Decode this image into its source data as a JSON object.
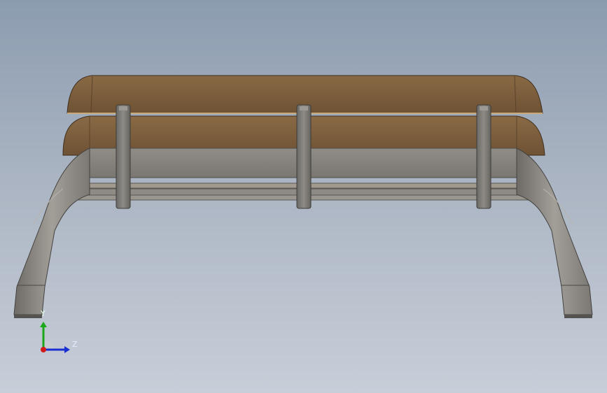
{
  "viewport": {
    "background_top": "#8c9cb0",
    "background_bottom": "#c7ced8"
  },
  "model": {
    "wood_color": "#7a5c3c",
    "wood_dark": "#5e4329",
    "metal_color": "#8a8680",
    "metal_dark": "#5a5855",
    "post_count": 3
  },
  "triad": {
    "y_label": "Y",
    "z_label": "Z",
    "y_color": "#1aa81a",
    "z_color": "#1a2fd1",
    "x_color": "#d11a1a"
  }
}
